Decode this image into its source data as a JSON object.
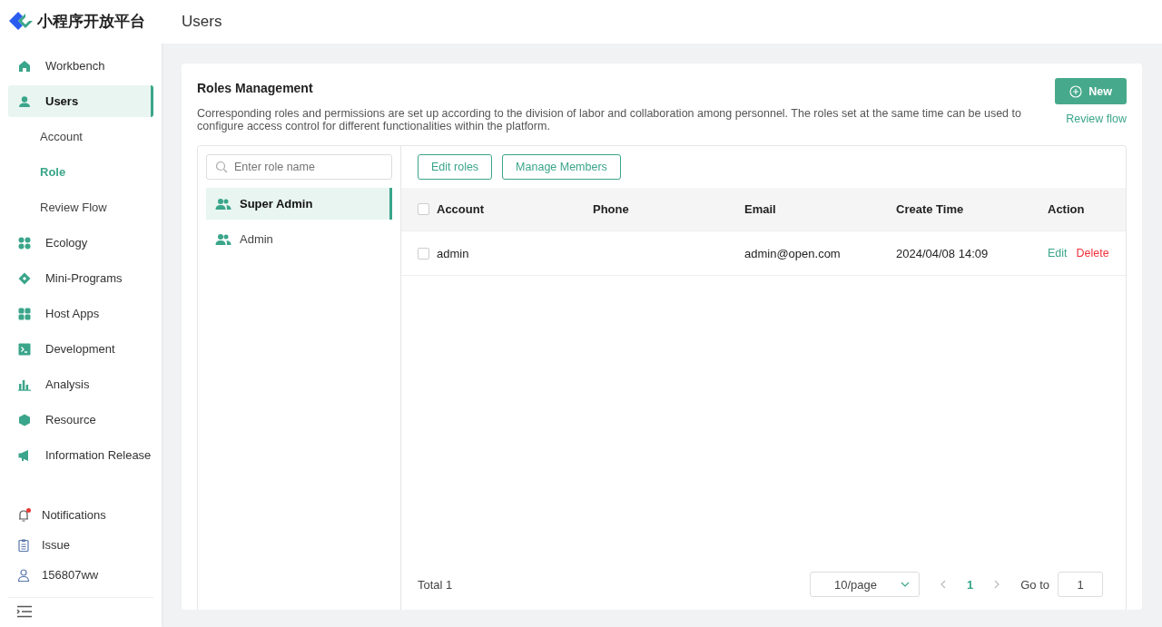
{
  "logo": {
    "title": "小程序开放平台"
  },
  "nav": [
    {
      "label": "Workbench",
      "kind": "home",
      "selected": false
    },
    {
      "label": "Users",
      "kind": "user",
      "selected": true,
      "children": [
        {
          "label": "Account",
          "selected": false
        },
        {
          "label": "Role",
          "selected": true
        },
        {
          "label": "Review Flow",
          "selected": false
        }
      ]
    },
    {
      "label": "Ecology",
      "kind": "clover",
      "selected": false
    },
    {
      "label": "Mini-Programs",
      "kind": "diamond",
      "selected": false
    },
    {
      "label": "Host Apps",
      "kind": "grid",
      "selected": false
    },
    {
      "label": "Development",
      "kind": "terminal",
      "selected": false
    },
    {
      "label": "Analysis",
      "kind": "bars",
      "selected": false
    },
    {
      "label": "Resource",
      "kind": "cube",
      "selected": false
    },
    {
      "label": "Information Release",
      "kind": "megaphone",
      "selected": false
    }
  ],
  "bottom_nav": [
    {
      "label": "Notifications",
      "kind": "bell",
      "unread": true
    },
    {
      "label": "Issue",
      "kind": "clipboard",
      "unread": false
    },
    {
      "label": "156807ww",
      "kind": "person",
      "unread": false
    }
  ],
  "page_title": "Users",
  "card": {
    "title": "Roles Management",
    "description": "Corresponding roles and permissions are set up according to the division of labor and collaboration among personnel. The roles set at the same time can be used to configure access control for different functionalities within the platform.",
    "new_button": "New",
    "review_link": "Review flow"
  },
  "roles": {
    "search": {
      "placeholder": "Enter role name"
    },
    "items": [
      {
        "name": "Super Admin",
        "selected": true
      },
      {
        "name": "Admin",
        "selected": false
      }
    ]
  },
  "toolbar": [
    "Edit roles",
    "Manage Members"
  ],
  "table": {
    "select_all": false,
    "columns": [
      "Account",
      "Phone",
      "Email",
      "Create Time",
      "Action"
    ],
    "rows": [
      {
        "checked": false,
        "account": "admin",
        "email": "admin@open.com",
        "create_time": "2024/04/08 14:09",
        "actions": [
          {
            "label": "Edit",
            "kind": "edit"
          },
          {
            "label": "Delete",
            "kind": "delete"
          }
        ]
      }
    ]
  },
  "pagination": {
    "total": "Total 1",
    "page_size": "10/page",
    "pages": [
      {
        "label": "1",
        "selected": true
      }
    ],
    "goto_label": "Go to",
    "goto_value": "1"
  }
}
